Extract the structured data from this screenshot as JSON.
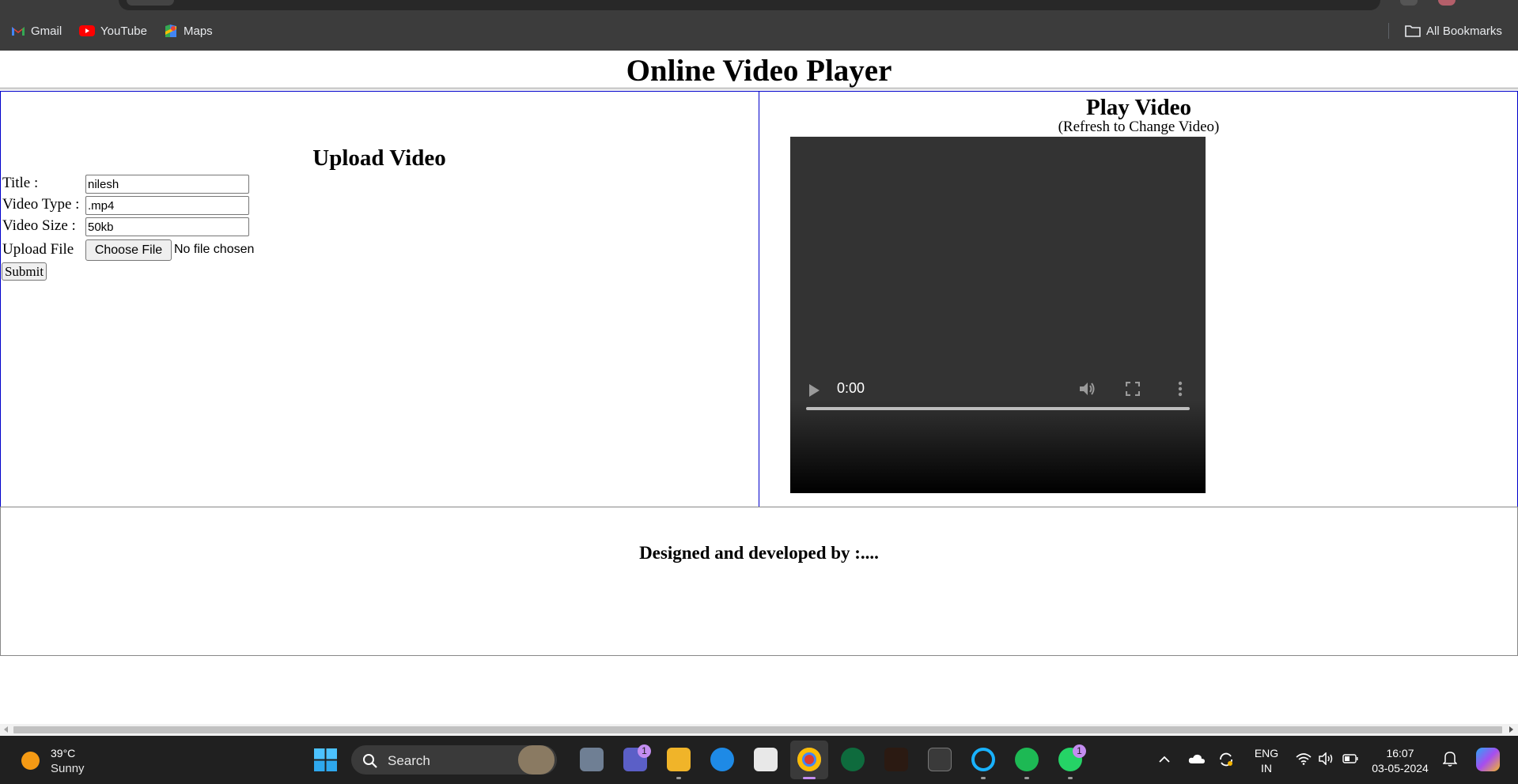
{
  "browser": {
    "bookmarks": [
      {
        "label": "Gmail",
        "icon": "gmail-icon"
      },
      {
        "label": "YouTube",
        "icon": "youtube-icon"
      },
      {
        "label": "Maps",
        "icon": "maps-icon"
      }
    ],
    "all_bookmarks": "All Bookmarks"
  },
  "page": {
    "title": "Online Video Player",
    "upload": {
      "heading": "Upload Video",
      "title_label": "Title :",
      "title_value": "nilesh",
      "type_label": "Video Type :",
      "type_value": ".mp4",
      "size_label": "Video Size :",
      "size_value": "50kb",
      "file_label": "Upload File",
      "choose_file": "Choose File",
      "no_file": "No file chosen",
      "submit": "Submit"
    },
    "player": {
      "heading": "Play Video",
      "subheading": "(Refresh to Change Video)",
      "time": "0:00"
    },
    "footer": "Designed and developed by :...."
  },
  "taskbar": {
    "weather_temp": "39°C",
    "weather_cond": "Sunny",
    "search_label": "Search",
    "teams_badge": "1",
    "whatsapp_badge": "1",
    "lang_top": "ENG",
    "lang_bottom": "IN",
    "time": "16:07",
    "date": "03-05-2024"
  },
  "colors": {
    "border_blue": "#0000cc",
    "chrome_dark": "#3c3c3c",
    "taskbar": "#202020"
  }
}
